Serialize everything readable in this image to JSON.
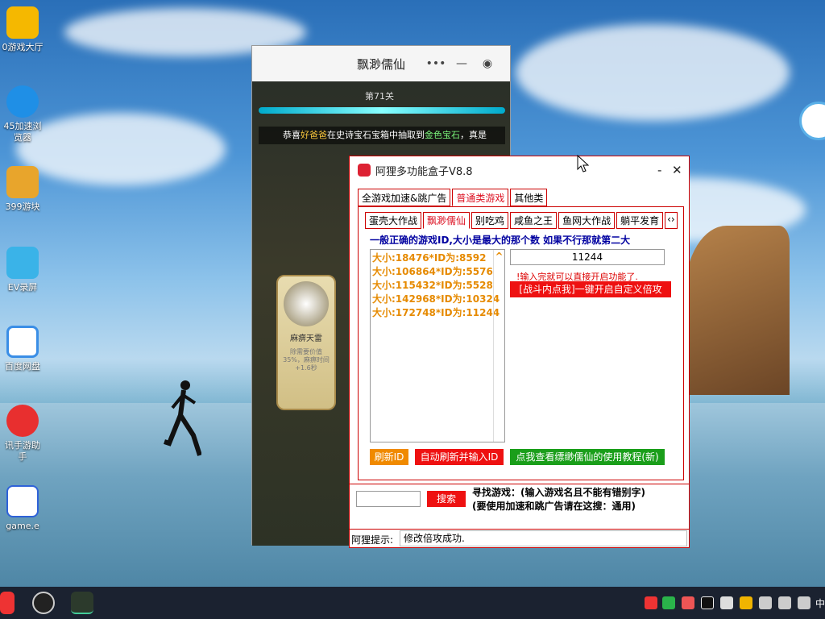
{
  "desktop": {
    "icons": [
      {
        "label": "0游戏大厅",
        "color": "#f5b800"
      },
      {
        "label": "45加速浏\n览器",
        "color": "#1f8fe6"
      },
      {
        "label": "399游块",
        "color": "#e8a52c"
      },
      {
        "label": "EV录屏",
        "color": "#3ab3e8"
      },
      {
        "label": "百度网盘",
        "color": "#e84a4a"
      },
      {
        "label": "讯手游助\n手",
        "color": "#e82f2f"
      },
      {
        "label": "game.e",
        "color": "#2f62d8"
      }
    ]
  },
  "game_window": {
    "title": "飘渺儒仙",
    "stage": "第71关",
    "notice_prefix": "恭喜",
    "notice_name": "好爸爸",
    "notice_mid": "在史诗宝石宝箱中抽取到",
    "notice_item": "金色宝石",
    "notice_suffix": "，真是",
    "skill_name": "麻痹天雷",
    "skill_desc": "除需要价值\n35%，麻痹时间\n+1.6秒"
  },
  "tool_window": {
    "title": "阿狸多功能盒子V8.8",
    "tabs": [
      "全游戏加速&跳广告",
      "普通类游戏",
      "其他类"
    ],
    "selected_tab": 1,
    "game_tabs": [
      "蛋壳大作战",
      "飘渺儒仙",
      "别吃鸡",
      "咸鱼之王",
      "鱼网大作战",
      "躺平发育"
    ],
    "selected_game_tab": 1,
    "hint": "一般正确的游戏ID,大小是最大的那个数  如果不行那就第二大",
    "ids": [
      "大小:18476*ID为:8592",
      "大小:106864*ID为:5576",
      "大小:115432*ID为:5528",
      "大小:142968*ID为:10324",
      "大小:172748*ID为:11244"
    ],
    "id_value": "11244",
    "id_note": "!输入完就可以直接开启功能了.",
    "enable_button": "[战斗内点我]一键开启自定义倍攻",
    "refresh_button": "刷新ID",
    "auto_button": "自动刷新并输入ID",
    "tutorial_button": "点我查看缥缈儒仙的使用教程(新)",
    "search_button": "搜索",
    "search_text_1": "寻找游戏：(输入游戏名且不能有错别字)",
    "search_text_2": "(要使用加速和跳广告请在这搜：通用)",
    "status_label": "阿狸提示:",
    "status_value": "修改倍攻成功."
  },
  "taskbar": {
    "tray_time": "中"
  }
}
